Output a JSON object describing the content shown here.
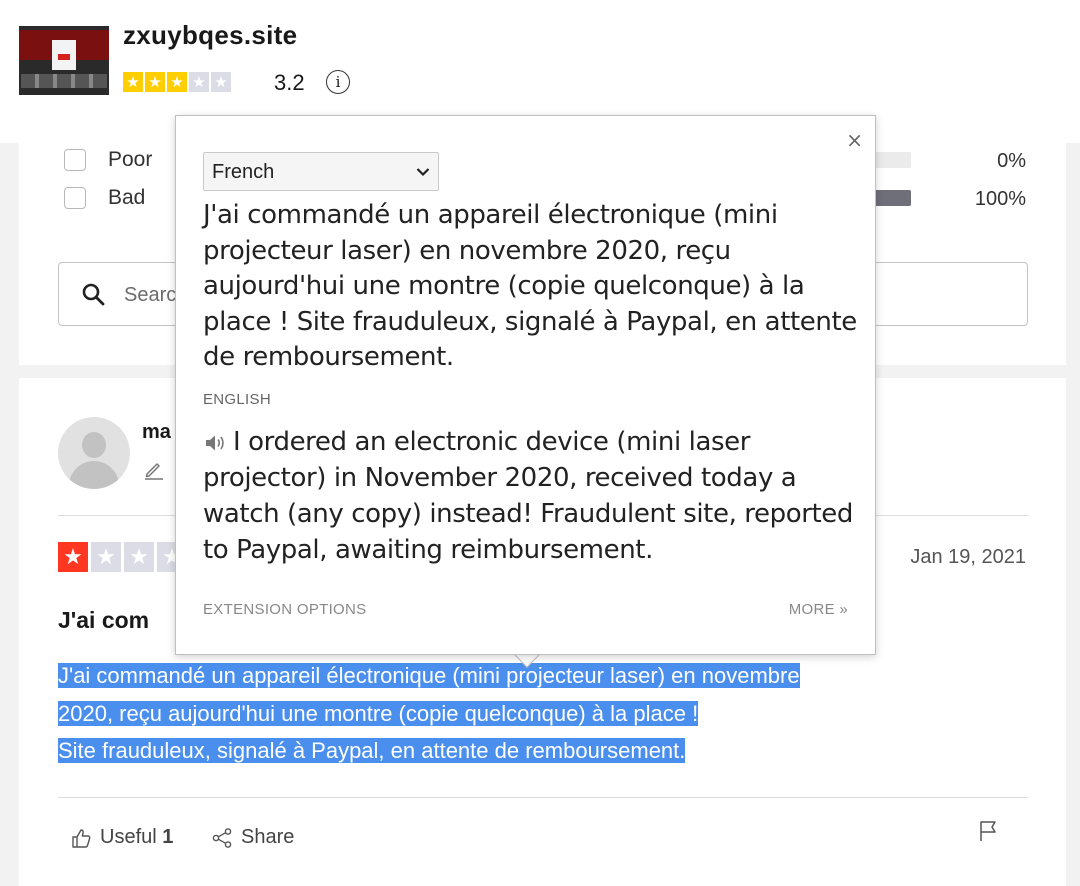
{
  "header": {
    "site_name": "zxuybqes.site",
    "rating_score": "3.2",
    "rating_stars": 3,
    "info_glyph": "i"
  },
  "filters": {
    "rows": [
      {
        "label": "Poor",
        "percent": "0%",
        "fill": 0
      },
      {
        "label": "Bad",
        "percent": "100%",
        "fill": 1
      }
    ],
    "search_placeholder": "Search"
  },
  "review": {
    "reviewer_initial": "ma",
    "rating_stars": 1,
    "date": "Jan 19, 2021",
    "title": "J'ai com",
    "body_lines": [
      "J'ai commandé un appareil électronique (mini projecteur laser) en novembre",
      "2020, reçu aujourd'hui une montre (copie quelconque) à la place !",
      "Site frauduleux, signalé à Paypal, en attente de remboursement."
    ],
    "useful_label": "Useful",
    "useful_count": "1",
    "share_label": "Share"
  },
  "translate_popup": {
    "close_glyph": "×",
    "source_language": "French",
    "original_text": "J'ai commandé un appareil électronique (mini projecteur laser) en novembre 2020, reçu aujourd'hui une montre (copie quelconque) à la place ! Site frauduleux, signalé à Paypal, en attente de remboursement.",
    "target_language": "ENGLISH",
    "translated_text": "I ordered an electronic device (mini laser projector) in November 2020, received today a watch (any copy) instead! Fraudulent site, reported to Paypal, awaiting reimbursement.",
    "extension_options": "EXTENSION OPTIONS",
    "more_link": "MORE »"
  },
  "colors": {
    "star_gold": "#ffce00",
    "star_red": "#ff3722",
    "selection_blue": "#4a8fed"
  }
}
